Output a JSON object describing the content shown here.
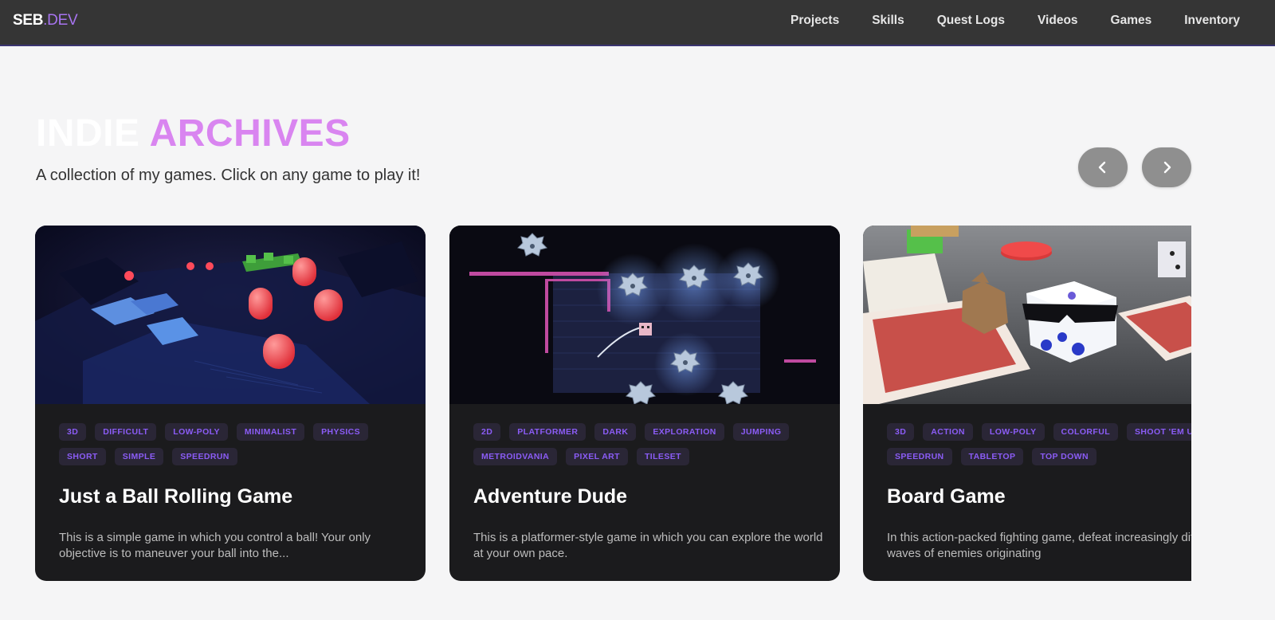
{
  "nav": {
    "logo_main": "SEB",
    "logo_accent": ".DEV",
    "links": [
      "Projects",
      "Skills",
      "Quest Logs",
      "Videos",
      "Games",
      "Inventory"
    ]
  },
  "hero": {
    "title_part1": "INDIE",
    "title_part2": "ARCHIVES",
    "subtitle": "A collection of my games. Click on any game to play it!"
  },
  "carousel": {
    "prev_icon": "chevron-left-icon",
    "next_icon": "chevron-right-icon"
  },
  "cards": [
    {
      "tags": [
        "3D",
        "DIFFICULT",
        "LOW-POLY",
        "MINIMALIST",
        "PHYSICS",
        "SHORT",
        "SIMPLE",
        "SPEEDRUN"
      ],
      "title": "Just a Ball Rolling Game",
      "description": "This is a simple game in which you control a ball! Your only objective is to maneuver your ball into the..."
    },
    {
      "tags": [
        "2D",
        "PLATFORMER",
        "DARK",
        "EXPLORATION",
        "JUMPING",
        "METROIDVANIA",
        "PIXEL ART",
        "TILESET"
      ],
      "title": "Adventure Dude",
      "description": "This is a platformer-style game in which you can explore the world at your own pace."
    },
    {
      "tags": [
        "3D",
        "ACTION",
        "LOW-POLY",
        "COLORFUL",
        "SHOOT 'EM UP",
        "SPEEDRUN",
        "TABLETOP",
        "TOP DOWN"
      ],
      "title": "Board Game",
      "description": "In this action-packed fighting game, defeat increasingly difficult waves of enemies originating"
    }
  ],
  "colors": {
    "accent": "#d985f0",
    "tag_text": "#8b5cf6",
    "card_bg": "#1b1b1d",
    "nav_bg": "#353535"
  }
}
